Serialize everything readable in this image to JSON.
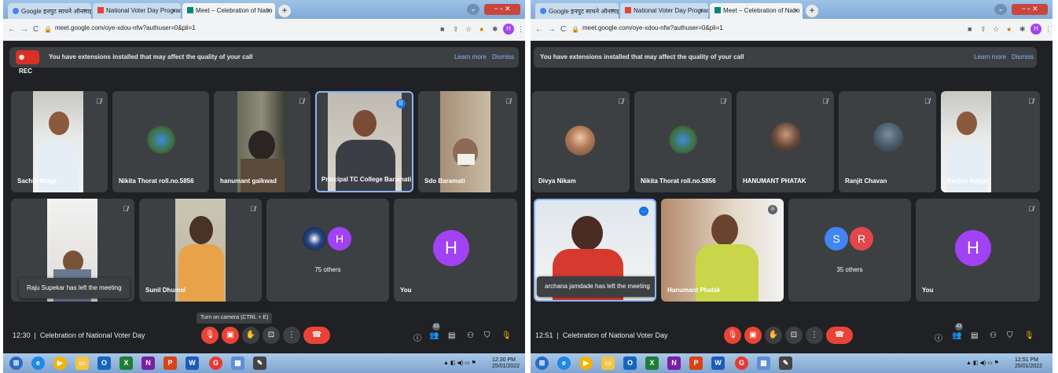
{
  "left": {
    "tabs": [
      {
        "label": "Google इनपुट साधने ऑनलाइन वा"
      },
      {
        "label": "National Voter Day Program Go"
      },
      {
        "label": "Meet – Celebration of Natio"
      }
    ],
    "url": "meet.google.com/oye-xdou-nfw?authuser=0&pli=1",
    "rec_label": "REC",
    "banner_text": "You have extensions installed that may affect the quality of your call",
    "learn_more": "Learn more",
    "dismiss": "Dismiss",
    "tiles_row1": [
      "Sachin Nalge",
      "Nikita Thorat roll.no.5856",
      "hanumant gaikwad",
      "Principal TC College Baramati",
      "Sdo Baramati"
    ],
    "tiles_row2": [
      "Raju Supekar",
      "Sunil Dhumal",
      "75 others",
      "You"
    ],
    "toast": "Raju Supekar has left the meeting",
    "others_letter": "H",
    "you_letter": "H",
    "time": "12:30",
    "meeting": "Celebration of National Voter Day",
    "tooltip": "Turn on camera (CTRL + E)",
    "people_count": "83",
    "tray_time": "12:30 PM",
    "tray_date": "25/01/2022"
  },
  "right": {
    "tabs": [
      {
        "label": "Google इनपुट साधने ऑनलाइन वा"
      },
      {
        "label": "National Voter Day Program Go"
      },
      {
        "label": "Meet – Celebration of Natio"
      }
    ],
    "url": "meet.google.com/oye-xdou-nfw?authuser=0&pli=1",
    "banner_text": "You have extensions installed that may affect the quality of your call",
    "learn_more": "Learn more",
    "dismiss": "Dismiss",
    "tiles_row1": [
      "Divya Nikam",
      "Nikita Thorat roll.no.5856",
      "HANUMANT PHATAK",
      "Ranjit Chavan",
      "Sachin Nalge"
    ],
    "tiles_row2": [
      "archana jamdade",
      "Hanumant Phatak",
      "35 others",
      "You"
    ],
    "toast": "archana jamdade has left the meeting",
    "others_letters": [
      "S",
      "R"
    ],
    "you_letter": "H",
    "time": "12:51",
    "meeting": "Celebration of National Voter Day",
    "people_count": "43",
    "tray_time": "12:51 PM",
    "tray_date": "25/01/2022"
  },
  "colors": {
    "meet_bg": "#202124",
    "tile_bg": "#3c4043",
    "red": "#ea4335",
    "avatar_purple": "#a142f4",
    "avatar_blue": "#4285f4",
    "avatar_red": "#e2474b"
  },
  "icons": [
    "mic-off-icon",
    "camera-off-icon",
    "raise-hand-icon",
    "present-icon",
    "more-icon",
    "end-call-icon",
    "info-icon",
    "people-icon",
    "chat-icon",
    "activities-icon",
    "lock-icon",
    "mic-icon"
  ]
}
